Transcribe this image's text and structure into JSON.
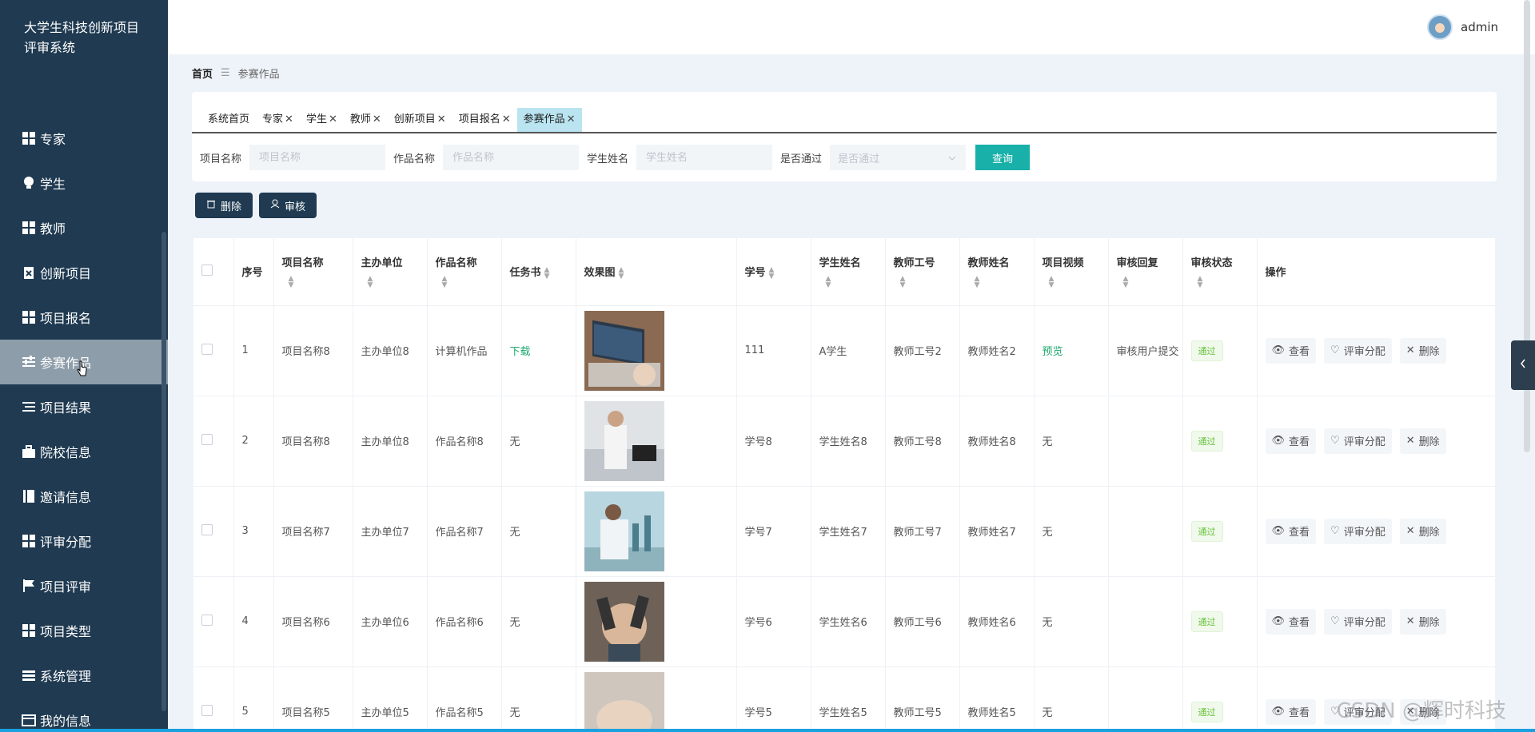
{
  "app_title": "大学生科技创新项目评审系统",
  "user": {
    "name": "admin"
  },
  "sidebar": {
    "items": [
      {
        "label": "专家",
        "icon": "grid-icon"
      },
      {
        "label": "学生",
        "icon": "bulb-icon"
      },
      {
        "label": "教师",
        "icon": "grid-icon"
      },
      {
        "label": "创新项目",
        "icon": "clipboard-icon"
      },
      {
        "label": "项目报名",
        "icon": "grid-icon"
      },
      {
        "label": "参赛作品",
        "icon": "sliders-icon",
        "active": true
      },
      {
        "label": "项目结果",
        "icon": "list-icon"
      },
      {
        "label": "院校信息",
        "icon": "briefcase-icon"
      },
      {
        "label": "邀请信息",
        "icon": "book-icon"
      },
      {
        "label": "评审分配",
        "icon": "grid-icon"
      },
      {
        "label": "项目评审",
        "icon": "flag-icon"
      },
      {
        "label": "项目类型",
        "icon": "grid-icon"
      },
      {
        "label": "系统管理",
        "icon": "menu-icon"
      },
      {
        "label": "我的信息",
        "icon": "card-icon"
      }
    ]
  },
  "breadcrumb": {
    "home": "首页",
    "sep": "☰",
    "current": "参赛作品"
  },
  "tabs": [
    {
      "label": "系统首页",
      "closable": false
    },
    {
      "label": "专家",
      "closable": true
    },
    {
      "label": "学生",
      "closable": true
    },
    {
      "label": "教师",
      "closable": true
    },
    {
      "label": "创新项目",
      "closable": true
    },
    {
      "label": "项目报名",
      "closable": true
    },
    {
      "label": "参赛作品",
      "closable": true,
      "active": true
    }
  ],
  "search": {
    "project_label": "项目名称",
    "project_placeholder": "项目名称",
    "work_label": "作品名称",
    "work_placeholder": "作品名称",
    "student_label": "学生姓名",
    "student_placeholder": "学生姓名",
    "pass_label": "是否通过",
    "pass_placeholder": "是否通过",
    "query_label": "查询"
  },
  "toolbar": {
    "delete_label": "删除",
    "audit_label": "审核"
  },
  "table": {
    "headers": {
      "index": "序号",
      "project_name": "项目名称",
      "organizer": "主办单位",
      "work_name": "作品名称",
      "task_book": "任务书",
      "effect_image": "效果图",
      "student_no": "学号",
      "student_name": "学生姓名",
      "teacher_no": "教师工号",
      "teacher_name": "教师姓名",
      "video": "项目视频",
      "reply": "审核回复",
      "status": "审核状态",
      "ops": "操作"
    },
    "rows": [
      {
        "index": "1",
        "project_name": "项目名称8",
        "organizer": "主办单位8",
        "work_name": "计算机作品",
        "task_book": "下载",
        "student_no": "111",
        "student_name": "A学生",
        "teacher_no": "教师工号2",
        "teacher_name": "教师姓名2",
        "video": "预览",
        "reply": "审核用户提交",
        "status": "通过"
      },
      {
        "index": "2",
        "project_name": "项目名称8",
        "organizer": "主办单位8",
        "work_name": "作品名称8",
        "task_book": "无",
        "student_no": "学号8",
        "student_name": "学生姓名8",
        "teacher_no": "教师工号8",
        "teacher_name": "教师姓名8",
        "video": "无",
        "reply": "",
        "status": "通过"
      },
      {
        "index": "3",
        "project_name": "项目名称7",
        "organizer": "主办单位7",
        "work_name": "作品名称7",
        "task_book": "无",
        "student_no": "学号7",
        "student_name": "学生姓名7",
        "teacher_no": "教师工号7",
        "teacher_name": "教师姓名7",
        "video": "无",
        "reply": "",
        "status": "通过"
      },
      {
        "index": "4",
        "project_name": "项目名称6",
        "organizer": "主办单位6",
        "work_name": "作品名称6",
        "task_book": "无",
        "student_no": "学号6",
        "student_name": "学生姓名6",
        "teacher_no": "教师工号6",
        "teacher_name": "教师姓名6",
        "video": "无",
        "reply": "",
        "status": "通过"
      },
      {
        "index": "5",
        "project_name": "项目名称5",
        "organizer": "主办单位5",
        "work_name": "作品名称5",
        "task_book": "无",
        "student_no": "学号5",
        "student_name": "学生姓名5",
        "teacher_no": "教师工号5",
        "teacher_name": "教师姓名5",
        "video": "无",
        "reply": "",
        "status": "通过"
      }
    ],
    "ops": {
      "view": "查看",
      "assign": "评审分配",
      "delete": "删除"
    }
  },
  "watermark": "CSDN @辉时科技",
  "colors": {
    "sidebar_bg": "#1f3a51",
    "accent": "#18b0a8",
    "active_tab": "#b9e4f0",
    "pass_green": "#67c23a"
  }
}
